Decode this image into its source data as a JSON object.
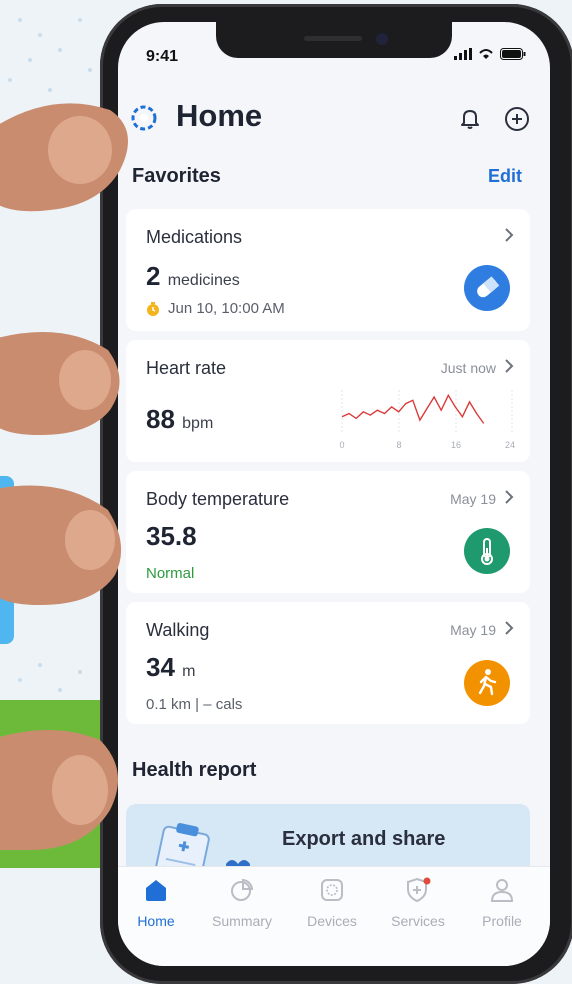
{
  "status": {
    "time": "9:41"
  },
  "header": {
    "title": "Home"
  },
  "favorites": {
    "title": "Favorites",
    "edit_label": "Edit"
  },
  "cards": {
    "medications": {
      "title": "Medications",
      "value": "2",
      "unit": "medicines",
      "time": "Jun 10, 10:00 AM"
    },
    "heart_rate": {
      "title": "Heart rate",
      "updated": "Just now",
      "value": "88",
      "unit": "bpm",
      "chart_ticks": [
        "0",
        "8",
        "16",
        "24"
      ],
      "chart_data": {
        "type": "line",
        "x": [
          0,
          1,
          2,
          3,
          4,
          5,
          6,
          7,
          8,
          9,
          10,
          11,
          12,
          13,
          14,
          15,
          16,
          17,
          18,
          19,
          20
        ],
        "values": [
          80,
          82,
          79,
          83,
          81,
          84,
          82,
          86,
          83,
          88,
          90,
          78,
          85,
          92,
          84,
          93,
          86,
          80,
          89,
          82,
          76
        ],
        "xlim": [
          0,
          24
        ],
        "color": "#d93b3b"
      }
    },
    "body_temperature": {
      "title": "Body temperature",
      "date": "May 19",
      "value": "35.8",
      "status": "Normal"
    },
    "walking": {
      "title": "Walking",
      "date": "May 19",
      "value": "34",
      "unit": "m",
      "sub": "0.1 km | – cals"
    }
  },
  "report": {
    "title": "Health report",
    "export_label": "Export and share"
  },
  "tabs": [
    {
      "label": "Home"
    },
    {
      "label": "Summary"
    },
    {
      "label": "Devices"
    },
    {
      "label": "Services"
    },
    {
      "label": "Profile"
    }
  ],
  "colors": {
    "accent": "#1f6fd6",
    "med": "#2f7de0",
    "temp": "#1f9a6e",
    "walk": "#f39200",
    "normal": "#2e9a3e"
  },
  "icons": [
    "logo-icon",
    "bell-icon",
    "add-circle-icon",
    "pill-icon",
    "thermometer-icon",
    "walking-icon",
    "clock-icon"
  ]
}
